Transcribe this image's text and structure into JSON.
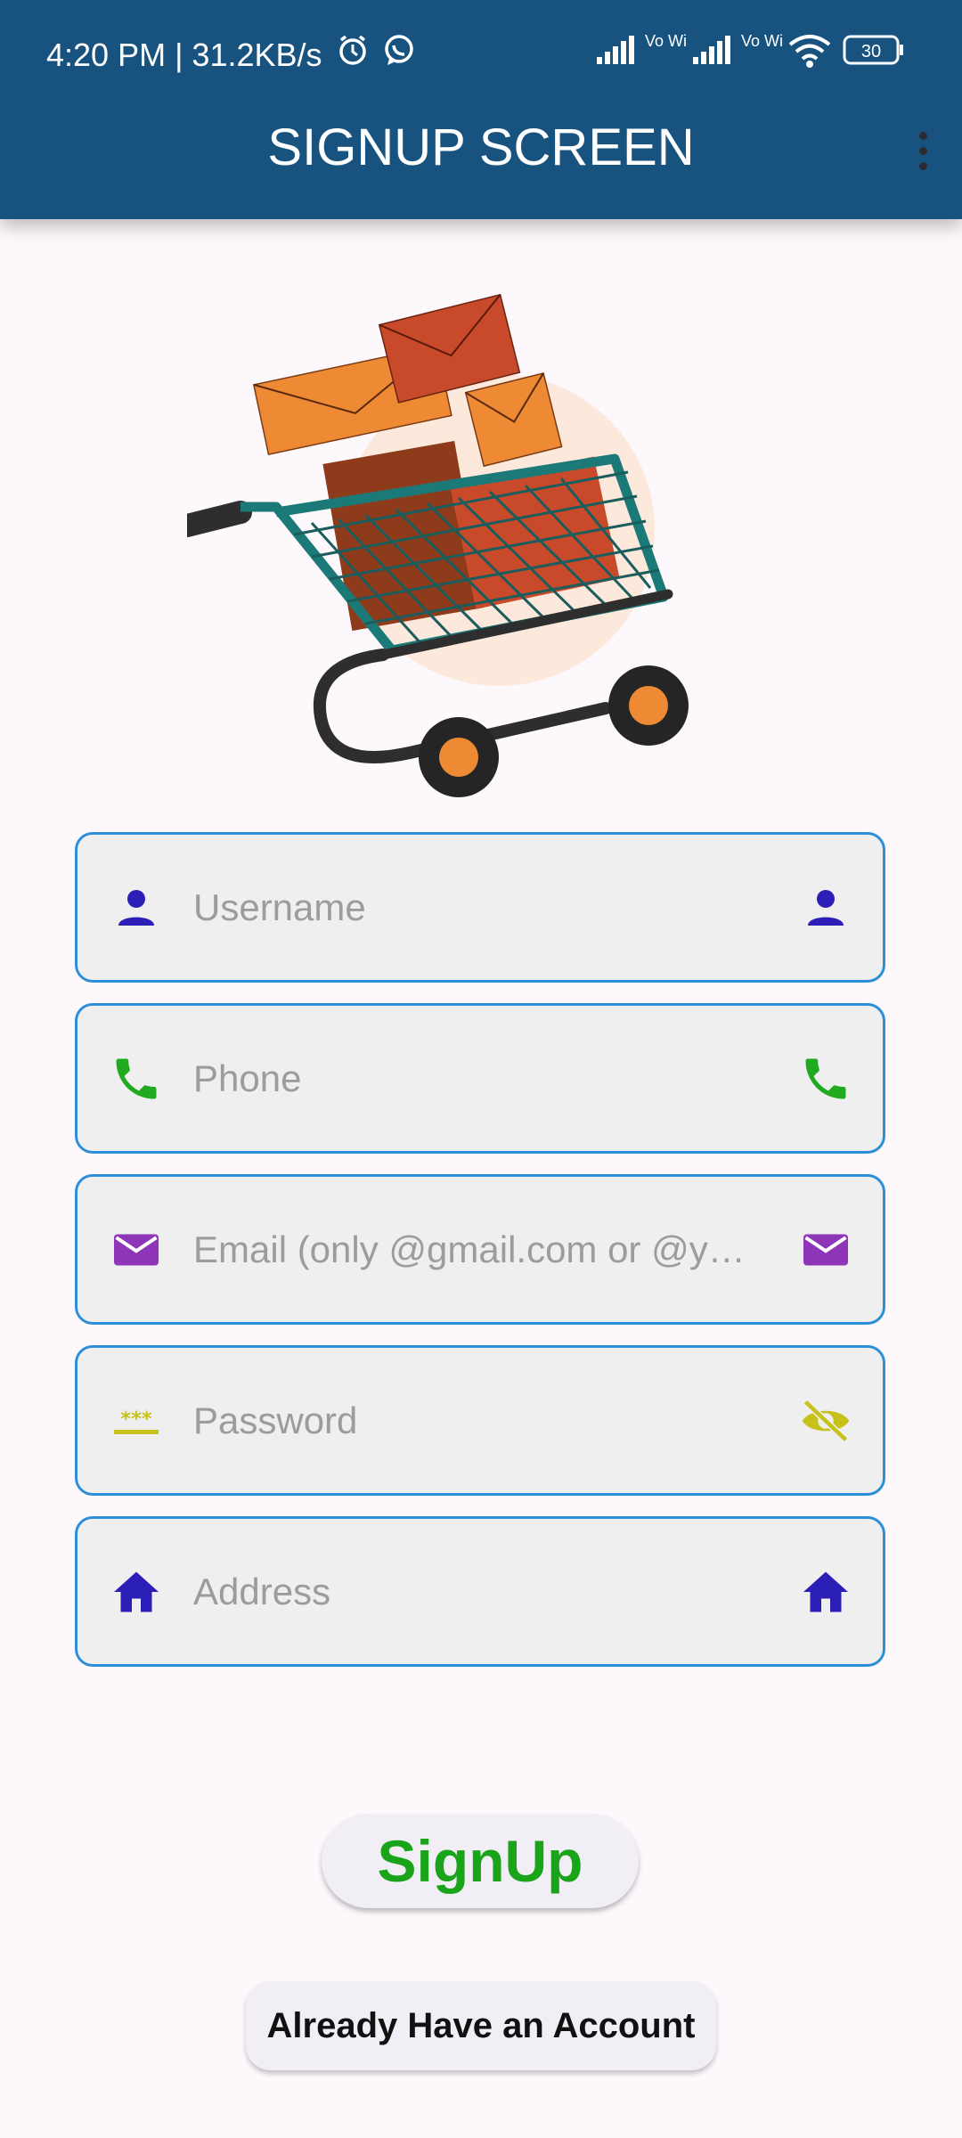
{
  "status_bar": {
    "time_speed": "4:20 PM | 31.2KB/s",
    "network_label_1": "Vo WiFi",
    "network_label_2": "Vo WiFi",
    "battery": "30"
  },
  "app_bar": {
    "title": "SIGNUP SCREEN"
  },
  "form": {
    "username": {
      "placeholder": "Username",
      "icon": "person-icon",
      "color": "#2b1fb8"
    },
    "phone": {
      "placeholder": "Phone",
      "icon": "phone-icon",
      "color": "#1faa1f"
    },
    "email": {
      "placeholder": "Email (only @gmail.com or @y…",
      "icon": "mail-icon",
      "color": "#8e35b8"
    },
    "password": {
      "placeholder": "Password",
      "icon": "password-icon",
      "trailing_icon": "visibility-off-icon",
      "color": "#c7c21a"
    },
    "address": {
      "placeholder": "Address",
      "icon": "home-icon",
      "color": "#2b1fb8"
    }
  },
  "buttons": {
    "signup": "SignUp",
    "already_have_account": "Already Have an Account"
  },
  "colors": {
    "app_bar": "#185380",
    "field_border": "#2d8fd8",
    "signup_text": "#1aa41a"
  }
}
